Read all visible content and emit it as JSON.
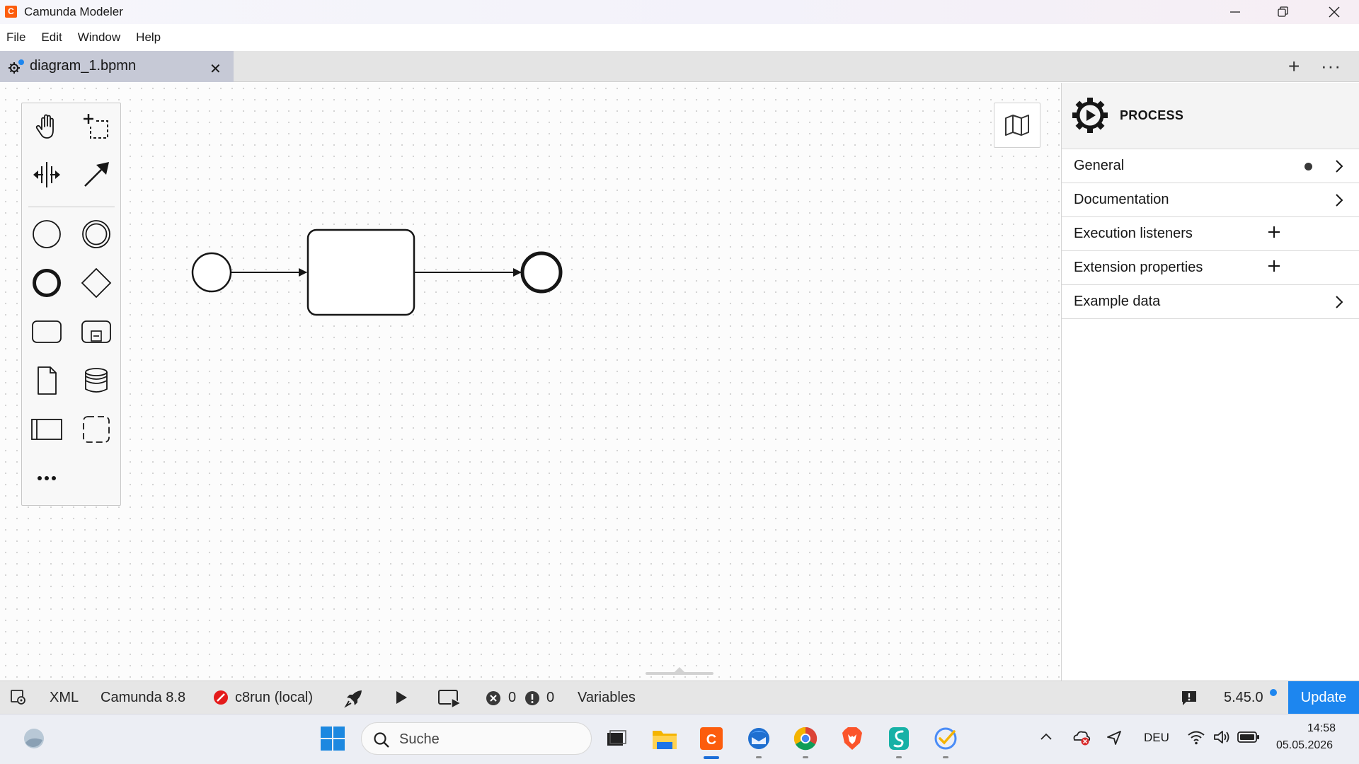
{
  "window": {
    "title": "Camunda Modeler",
    "app_icon_glyph": "C"
  },
  "menu": [
    "File",
    "Edit",
    "Window",
    "Help"
  ],
  "tabs": [
    {
      "label": "diagram_1.bpmn",
      "close": "✕"
    }
  ],
  "tabbar": {
    "add": "+",
    "more": "···"
  },
  "properties": {
    "element_type": "PROCESS",
    "groups": [
      {
        "label": "General",
        "indicator": "dot",
        "action": "chevron"
      },
      {
        "label": "Documentation",
        "action": "chevron"
      },
      {
        "label": "Execution listeners",
        "action": "plus"
      },
      {
        "label": "Extension properties",
        "action": "plus"
      },
      {
        "label": "Example data",
        "action": "chevron"
      }
    ]
  },
  "statusbar": {
    "xml": "XML",
    "platform": "Camunda 8.8",
    "engine": "c8run (local)",
    "errors": "0",
    "warnings": "0",
    "variables": "Variables",
    "version": "5.45.0",
    "update": "Update"
  },
  "taskbar": {
    "search_placeholder": "Suche",
    "language": "DEU",
    "time": "14:58",
    "date": "05.05.2026"
  },
  "colors": {
    "accent": "#1d86ef",
    "brand": "#fc5d0d",
    "engine_error": "#e41b1b"
  }
}
